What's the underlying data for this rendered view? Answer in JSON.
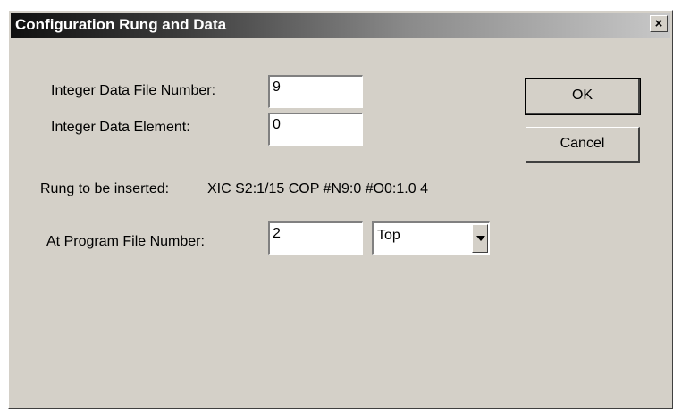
{
  "window": {
    "title": "Configuration Rung and Data",
    "close_label": "×"
  },
  "form": {
    "file_number_label": "Integer Data File Number:",
    "file_number_value": "9",
    "element_label": "Integer Data Element:",
    "element_value": "0",
    "rung_label": "Rung to be inserted:",
    "rung_value": "XIC S2:1/15 COP #N9:0 #O0:1.0 4",
    "program_file_label": "At Program File Number:",
    "program_file_value": "2",
    "position_selected": "Top"
  },
  "buttons": {
    "ok": "OK",
    "cancel": "Cancel"
  }
}
